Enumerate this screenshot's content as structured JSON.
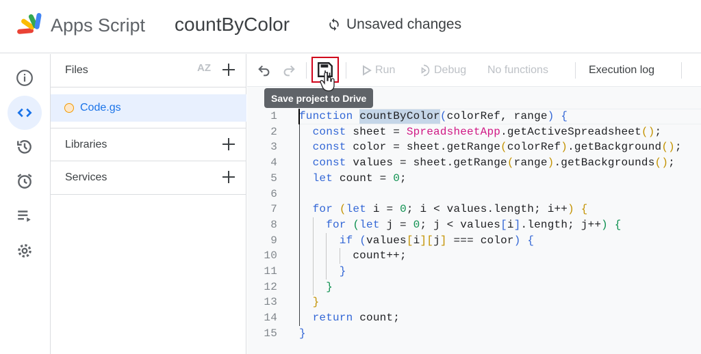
{
  "header": {
    "app_name": "Apps Script",
    "project_title": "countByColor",
    "status": "Unsaved changes"
  },
  "rail": {
    "items": [
      {
        "name": "overview",
        "icon": "info-icon"
      },
      {
        "name": "editor",
        "icon": "code-icon",
        "active": true
      },
      {
        "name": "project-history",
        "icon": "history-icon"
      },
      {
        "name": "triggers",
        "icon": "alarm-icon"
      },
      {
        "name": "executions",
        "icon": "list-play-icon"
      },
      {
        "name": "settings",
        "icon": "gear-icon"
      }
    ]
  },
  "files": {
    "title": "Files",
    "sort_label": "AZ",
    "items": [
      {
        "name": "Code.gs"
      }
    ],
    "libraries": "Libraries",
    "services": "Services"
  },
  "toolbar": {
    "run": "Run",
    "debug": "Debug",
    "function_select": "No functions",
    "execution_log": "Execution log",
    "tooltip": "Save project to Drive"
  },
  "code": {
    "lines": [
      {
        "n": "1",
        "indent": 0,
        "tokens": [
          [
            "function ",
            "kw"
          ],
          [
            "countByColor",
            "tx hl"
          ],
          [
            "(",
            "p1"
          ],
          [
            "colorRef, range",
            "tx"
          ],
          [
            ")",
            "p1"
          ],
          [
            " ",
            "tx"
          ],
          [
            "{",
            "p1"
          ]
        ]
      },
      {
        "n": "2",
        "indent": 1,
        "tokens": [
          [
            "const ",
            "kw"
          ],
          [
            "sheet = ",
            "tx"
          ],
          [
            "SpreadsheetApp",
            "cls"
          ],
          [
            ".getActiveSpreadsheet",
            "tx"
          ],
          [
            "()",
            "p2"
          ],
          [
            ";",
            "tx"
          ]
        ]
      },
      {
        "n": "3",
        "indent": 1,
        "tokens": [
          [
            "const ",
            "kw"
          ],
          [
            "color = sheet.getRange",
            "tx"
          ],
          [
            "(",
            "p2"
          ],
          [
            "colorRef",
            "tx"
          ],
          [
            ")",
            "p2"
          ],
          [
            ".getBackground",
            "tx"
          ],
          [
            "()",
            "p2"
          ],
          [
            ";",
            "tx"
          ]
        ]
      },
      {
        "n": "4",
        "indent": 1,
        "tokens": [
          [
            "const ",
            "kw"
          ],
          [
            "values = sheet.getRange",
            "tx"
          ],
          [
            "(",
            "p2"
          ],
          [
            "range",
            "tx"
          ],
          [
            ")",
            "p2"
          ],
          [
            ".getBackgrounds",
            "tx"
          ],
          [
            "()",
            "p2"
          ],
          [
            ";",
            "tx"
          ]
        ]
      },
      {
        "n": "5",
        "indent": 1,
        "tokens": [
          [
            "let ",
            "kw"
          ],
          [
            "count = ",
            "tx"
          ],
          [
            "0",
            "num"
          ],
          [
            ";",
            "tx"
          ]
        ]
      },
      {
        "n": "6",
        "indent": 1,
        "tokens": []
      },
      {
        "n": "7",
        "indent": 1,
        "tokens": [
          [
            "for ",
            "kw"
          ],
          [
            "(",
            "p2"
          ],
          [
            "let ",
            "kw"
          ],
          [
            "i = ",
            "tx"
          ],
          [
            "0",
            "num"
          ],
          [
            "; i < values.length; i++",
            "tx"
          ],
          [
            ")",
            "p2"
          ],
          [
            " ",
            "tx"
          ],
          [
            "{",
            "p2"
          ]
        ]
      },
      {
        "n": "8",
        "indent": 2,
        "tokens": [
          [
            "for ",
            "kw"
          ],
          [
            "(",
            "p3"
          ],
          [
            "let ",
            "kw"
          ],
          [
            "j = ",
            "tx"
          ],
          [
            "0",
            "num"
          ],
          [
            "; j < values",
            "tx"
          ],
          [
            "[",
            "p1"
          ],
          [
            "i",
            "tx"
          ],
          [
            "]",
            "p1"
          ],
          [
            ".length; j++",
            "tx"
          ],
          [
            ")",
            "p3"
          ],
          [
            " ",
            "tx"
          ],
          [
            "{",
            "p3"
          ]
        ]
      },
      {
        "n": "9",
        "indent": 3,
        "tokens": [
          [
            "if ",
            "kw"
          ],
          [
            "(",
            "p1"
          ],
          [
            "values",
            "tx"
          ],
          [
            "[",
            "p2"
          ],
          [
            "i",
            "tx"
          ],
          [
            "]",
            "p2"
          ],
          [
            "[",
            "p2"
          ],
          [
            "j",
            "tx"
          ],
          [
            "]",
            "p2"
          ],
          [
            " === color",
            "tx"
          ],
          [
            ")",
            "p1"
          ],
          [
            " ",
            "tx"
          ],
          [
            "{",
            "p1"
          ]
        ]
      },
      {
        "n": "10",
        "indent": 4,
        "tokens": [
          [
            "count++;",
            "tx"
          ]
        ]
      },
      {
        "n": "11",
        "indent": 3,
        "tokens": [
          [
            "}",
            "p1"
          ]
        ]
      },
      {
        "n": "12",
        "indent": 2,
        "tokens": [
          [
            "}",
            "p3"
          ]
        ]
      },
      {
        "n": "13",
        "indent": 1,
        "tokens": [
          [
            "}",
            "p2"
          ]
        ]
      },
      {
        "n": "14",
        "indent": 1,
        "tokens": [
          [
            "return ",
            "kw"
          ],
          [
            "count;",
            "tx"
          ]
        ]
      },
      {
        "n": "15",
        "indent": 0,
        "tokens": [
          [
            "}",
            "p1"
          ]
        ]
      }
    ]
  }
}
